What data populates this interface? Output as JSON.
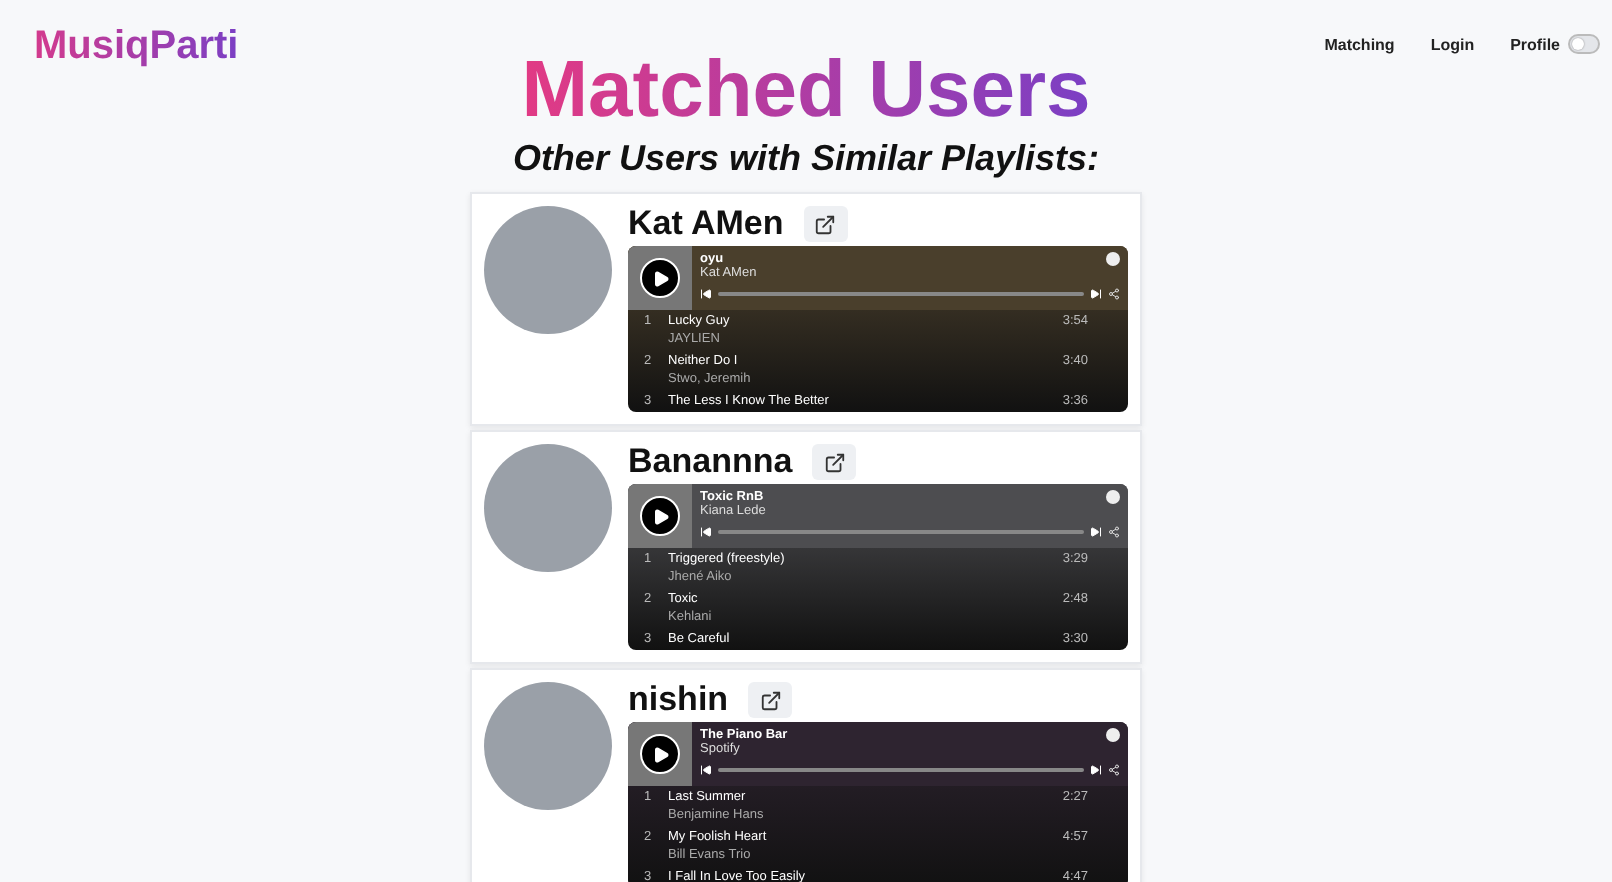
{
  "brand": "MusiqParti",
  "nav": [
    {
      "label": "Matching"
    },
    {
      "label": "Login"
    },
    {
      "label": "Profile"
    }
  ],
  "theme_switch": {
    "on": false
  },
  "title": "Matched Users",
  "subtitle": "Other Users with Similar Playlists:",
  "users": [
    {
      "name": "Kat AMen",
      "playlist": {
        "title": "oyu",
        "owner": "Kat AMen",
        "color": "#4a3f2c",
        "tracks": [
          {
            "number": "1",
            "title": "Lucky Guy",
            "artist": "JAYLIEN",
            "duration": "3:54"
          },
          {
            "number": "2",
            "title": "Neither Do I",
            "artist": "Stwo, Jeremih",
            "duration": "3:40"
          },
          {
            "number": "3",
            "title": "The Less I Know The Better",
            "duration": "3:36"
          }
        ]
      }
    },
    {
      "name": "Banannna",
      "playlist": {
        "title": "Toxic RnB",
        "owner": "Kiana Lede",
        "color": "#4d4d50",
        "tracks": [
          {
            "number": "1",
            "title": "Triggered (freestyle)",
            "artist": "Jhené Aiko",
            "duration": "3:29"
          },
          {
            "number": "2",
            "title": "Toxic",
            "artist": "Kehlani",
            "duration": "2:48"
          },
          {
            "number": "3",
            "title": "Be Careful",
            "duration": "3:30"
          }
        ]
      }
    },
    {
      "name": "nishin",
      "playlist": {
        "title": "The Piano Bar",
        "owner": "Spotify",
        "color": "#2e2430",
        "tracks": [
          {
            "number": "1",
            "title": "Last Summer",
            "artist": "Benjamine Hans",
            "duration": "2:27"
          },
          {
            "number": "2",
            "title": "My Foolish Heart",
            "artist": "Bill Evans Trio",
            "duration": "4:57"
          },
          {
            "number": "3",
            "title": "I Fall In Love Too Easily",
            "duration": "4:47"
          }
        ]
      }
    }
  ]
}
